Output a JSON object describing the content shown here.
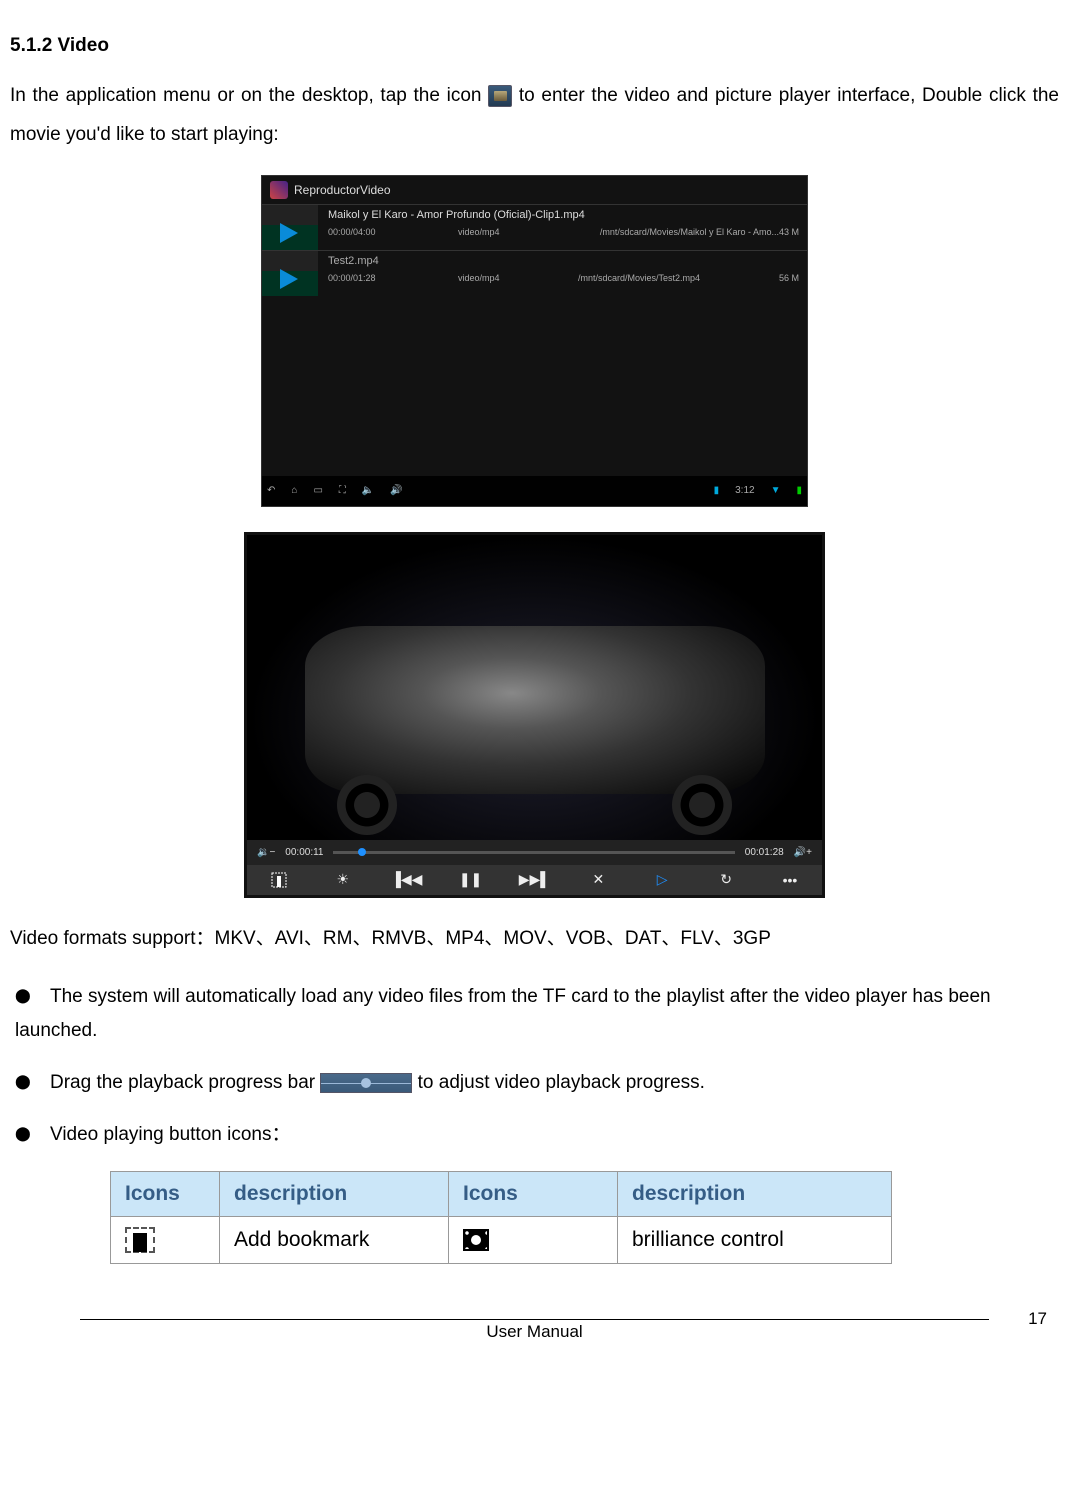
{
  "section": {
    "heading": "5.1.2 Video",
    "para1_a": "In the application menu or on the desktop, tap the icon ",
    "para1_b": " to enter the video and picture player interface, Double click the movie you'd like to start playing:"
  },
  "screenshot1": {
    "app_title": "ReproductorVideo",
    "rows": [
      {
        "title": "Maikol y El Karo - Amor Profundo (Oficial)-Clip1.mp4",
        "duration": "00:00/04:00",
        "type": "video/mp4",
        "path": "/mnt/sdcard/Movies/Maikol y El Karo - Amo...43 M"
      },
      {
        "title": "Test2.mp4",
        "duration": "00:00/01:28",
        "type": "video/mp4",
        "path": "/mnt/sdcard/Movies/Test2.mp4",
        "size": "56 M"
      }
    ],
    "status_time": "3:12"
  },
  "screenshot2": {
    "cur_time": "00:00:11",
    "total_time": "00:01:28"
  },
  "formats_line": "Video formats support：MKV、AVI、RM、RMVB、MP4、MOV、VOB、DAT、FLV、3GP",
  "bullets": [
    "The system will automatically load any video files from the TF card to the playlist after the video player has been launched.",
    "Drag the playback progress bar ",
    " to adjust video playback progress.",
    "Video playing button icons："
  ],
  "table": {
    "headers": [
      "Icons",
      "description",
      "Icons",
      "description"
    ],
    "row1": {
      "desc1": "Add bookmark",
      "desc2": "brilliance control"
    }
  },
  "footer": {
    "label": "User Manual",
    "page": "17"
  }
}
